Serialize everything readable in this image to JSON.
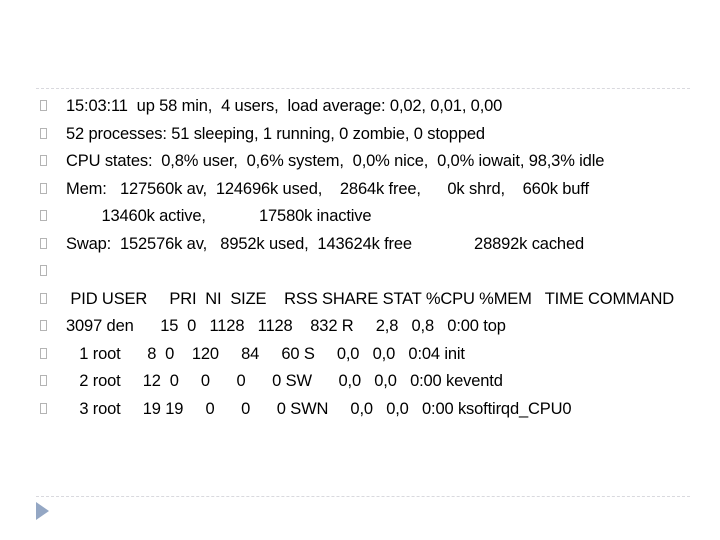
{
  "slide": {
    "bullet_glyph": "tofu-box",
    "accent_color": "#94a7c4",
    "rule_color": "#d9d9de",
    "text_color": "#000000",
    "nav_triangle_label": "next-slide-triangle"
  },
  "lines": [
    {
      "id": "uptime",
      "text": "15:03:11  up 58 min,  4 users,  load average: 0,02, 0,01, 0,00",
      "blank": false,
      "tabular": false
    },
    {
      "id": "processes",
      "text": "52 processes: 51 sleeping, 1 running, 0 zombie, 0 stopped",
      "blank": false,
      "tabular": false
    },
    {
      "id": "cpu-states",
      "text": "CPU states:  0,8% user,  0,6% system,  0,0% nice,  0,0% iowait, 98,3% idle",
      "blank": false,
      "tabular": false
    },
    {
      "id": "mem",
      "text": "Mem:   127560k av,  124696k used,    2864k free,      0k shrd,    660k buff",
      "blank": false,
      "tabular": false
    },
    {
      "id": "mem-active",
      "text": "        13460k active,            17580k inactive",
      "blank": false,
      "tabular": true
    },
    {
      "id": "swap",
      "text": "Swap:  152576k av,   8952k used,  143624k free              28892k cached",
      "blank": false,
      "tabular": true
    },
    {
      "id": "spacer",
      "text": "",
      "blank": true,
      "tabular": false
    },
    {
      "id": "table-header",
      "text": " PID USER     PRI  NI  SIZE    RSS SHARE STAT %CPU %MEM   TIME COMMAND",
      "blank": false,
      "tabular": true
    },
    {
      "id": "row-top",
      "text": "3097 den      15  0   1128   1128    832 R     2,8   0,8   0:00 top",
      "blank": false,
      "tabular": true
    },
    {
      "id": "row-init",
      "text": "   1 root      8  0    120     84     60 S     0,0   0,0   0:04 init",
      "blank": false,
      "tabular": true
    },
    {
      "id": "row-keventd",
      "text": "   2 root     12  0     0      0      0 SW      0,0   0,0   0:00 keventd",
      "blank": false,
      "tabular": true
    },
    {
      "id": "row-ksoftirqd",
      "text": "   3 root     19 19     0      0      0 SWN     0,0   0,0   0:00 ksoftirqd_CPU0",
      "blank": false,
      "tabular": true,
      "wraps": true
    }
  ],
  "top_output": {
    "command": "top",
    "time": "15:03:11",
    "uptime": "58 min",
    "users": 4,
    "load_average": [
      "0,02",
      "0,01",
      "0,00"
    ],
    "processes": {
      "total": 52,
      "sleeping": 51,
      "running": 1,
      "zombie": 0,
      "stopped": 0
    },
    "cpu_states": {
      "user": "0,8%",
      "system": "0,6%",
      "nice": "0,0%",
      "iowait": "0,0%",
      "idle": "98,3%"
    },
    "mem": {
      "av": "127560k",
      "used": "124696k",
      "free": "2864k",
      "shrd": "0k",
      "buff": "660k",
      "active": "13460k",
      "inactive": "17580k"
    },
    "swap": {
      "av": "152576k",
      "used": "8952k",
      "free": "143624k",
      "cached": "28892k"
    },
    "columns": [
      "PID",
      "USER",
      "PRI",
      "NI",
      "SIZE",
      "RSS",
      "SHARE",
      "STAT",
      "%CPU",
      "%MEM",
      "TIME",
      "COMMAND"
    ],
    "rows": [
      {
        "PID": "3097",
        "USER": "den",
        "PRI": "15",
        "NI": "0",
        "SIZE": "1128",
        "RSS": "1128",
        "SHARE": "832",
        "STAT": "R",
        "%CPU": "2,8",
        "%MEM": "0,8",
        "TIME": "0:00",
        "COMMAND": "top"
      },
      {
        "PID": "1",
        "USER": "root",
        "PRI": "8",
        "NI": "0",
        "SIZE": "120",
        "RSS": "84",
        "SHARE": "60",
        "STAT": "S",
        "%CPU": "0,0",
        "%MEM": "0,0",
        "TIME": "0:04",
        "COMMAND": "init"
      },
      {
        "PID": "2",
        "USER": "root",
        "PRI": "12",
        "NI": "0",
        "SIZE": "0",
        "RSS": "0",
        "SHARE": "0",
        "STAT": "SW",
        "%CPU": "0,0",
        "%MEM": "0,0",
        "TIME": "0:00",
        "COMMAND": "keventd"
      },
      {
        "PID": "3",
        "USER": "root",
        "PRI": "19",
        "NI": "19",
        "SIZE": "0",
        "RSS": "0",
        "SHARE": "0",
        "STAT": "SWN",
        "%CPU": "0,0",
        "%MEM": "0,0",
        "TIME": "0:00",
        "COMMAND": "ksoftirqd_CPU0"
      }
    ]
  }
}
